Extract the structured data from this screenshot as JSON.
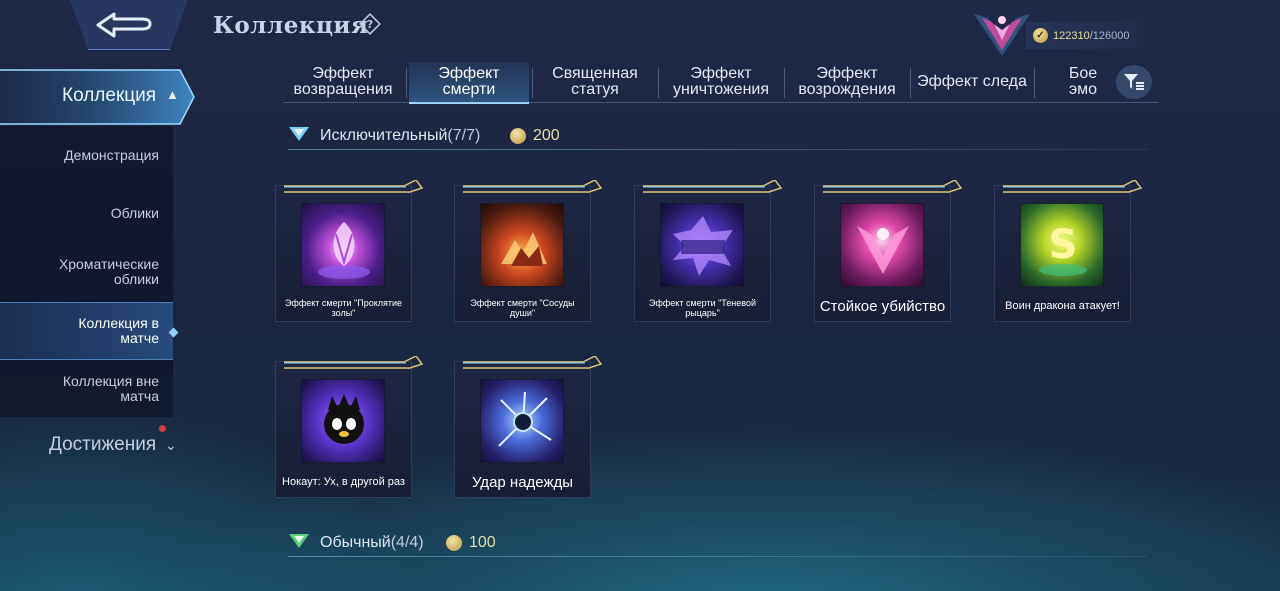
{
  "header": {
    "back_icon": "back-arrow-icon",
    "title": "Коллекция",
    "help_icon": "question-diamond-icon",
    "rank_icon": "rank-emblem-icon",
    "points_current": "122310",
    "points_max": "/126000",
    "points_icon": "collection-coin-icon"
  },
  "sidebar": {
    "active_label": "Коллекция",
    "items": [
      {
        "label": "Демонстрация"
      },
      {
        "label": "Облики"
      },
      {
        "label": "Хроматические облики"
      },
      {
        "label": "Коллекция в матче"
      },
      {
        "label": "Коллекция вне матча"
      }
    ],
    "achievements_label": "Достижения"
  },
  "tabs": [
    {
      "label": "Эффект возвращения"
    },
    {
      "label": "Эффект смерти"
    },
    {
      "label": "Священная статуя"
    },
    {
      "label": "Эффект уничтожения"
    },
    {
      "label": "Эффект возрождения"
    },
    {
      "label": "Эффект следа"
    },
    {
      "label": "Бое эмо"
    }
  ],
  "active_tab": "Эффект смерти",
  "filter_icon": "filter-icon",
  "sections": [
    {
      "name": "Исключительный",
      "count": "(7/7)",
      "price": "200",
      "items": [
        {
          "name": "Эффект смерти \"Проклятие золы\""
        },
        {
          "name": "Эффект смерти \"Сосуды души\""
        },
        {
          "name": "Эффект смерти \"Теневой рыцарь\""
        },
        {
          "name": "Стойкое убийство"
        },
        {
          "name": "Воин дракона атакует!"
        },
        {
          "name": "Нокаут: Ух, в другой раз"
        },
        {
          "name": "Удар надежды"
        }
      ]
    },
    {
      "name": "Обычный",
      "count": "(4/4)",
      "price": "100"
    }
  ],
  "colors": {
    "background": "#1d2742",
    "accent": "#9fdcff",
    "gold": "#e8dcae",
    "notification": "#d93c3c"
  }
}
